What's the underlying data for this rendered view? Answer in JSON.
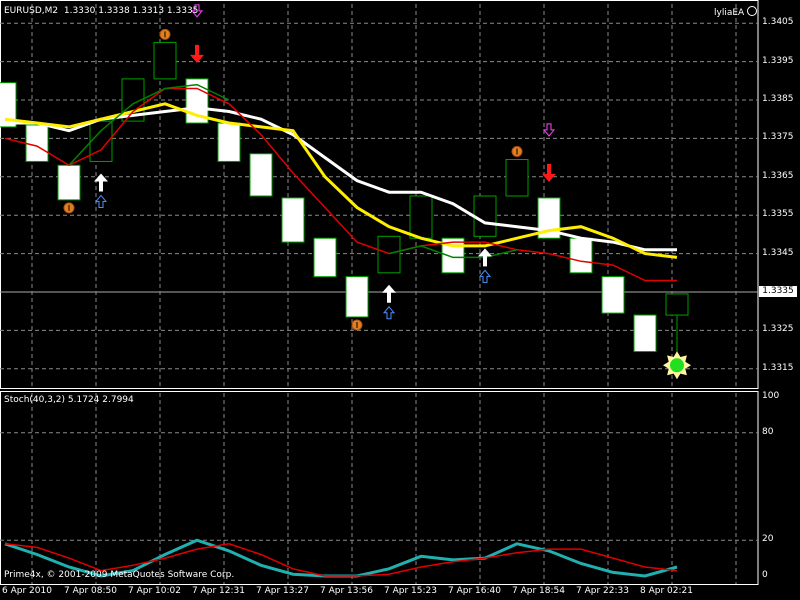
{
  "header": {
    "symbol": "EURUSD,M2",
    "quotes": "1.3330 1.3338 1.3313 1.3335",
    "ea_name": "lyliaEA"
  },
  "price_axis": {
    "ticks": [
      "1.3405",
      "1.3395",
      "1.3385",
      "1.3375",
      "1.3365",
      "1.3355",
      "1.3345",
      "1.3325",
      "1.3315"
    ],
    "current_price": "1.3335"
  },
  "stoch_panel": {
    "label": "Stoch(40,3,2) 5.1724 2.7994",
    "ticks": [
      "100",
      "80",
      "20",
      "0"
    ],
    "copyright": "Prime4x, © 2001-2009 MetaQuotes Software Corp."
  },
  "time_axis": {
    "labels": [
      "6 Apr 2010",
      "7 Apr 08:50",
      "7 Apr 10:02",
      "7 Apr 12:31",
      "7 Apr 13:27",
      "7 Apr 13:56",
      "7 Apr 15:23",
      "7 Apr 16:40",
      "7 Apr 18:54",
      "7 Apr 22:33",
      "8 Apr 02:21"
    ]
  },
  "colors": {
    "background": "#000000",
    "grid": "#8a8a8a",
    "bull_body": "#000000",
    "bear_body": "#ffffff",
    "candle_outline": "#00a000",
    "ma_red": "#e00000",
    "ma_green": "#008000",
    "ma_yellow": "#ffee00",
    "ma_white": "#ffffff",
    "stoch_main": "#20b0b0",
    "stoch_signal": "#e00000"
  },
  "chart_data": [
    {
      "type": "candlestick",
      "title": "EURUSD,M2",
      "ylim": [
        1.331,
        1.341
      ],
      "candles": [
        {
          "o": 1.33895,
          "c": 1.3378
        },
        {
          "o": 1.33785,
          "c": 1.3369
        },
        {
          "o": 1.3368,
          "c": 1.3359
        },
        {
          "o": 1.3369,
          "c": 1.33795
        },
        {
          "o": 1.33795,
          "c": 1.33905
        },
        {
          "o": 1.33905,
          "c": 1.34
        },
        {
          "o": 1.33905,
          "c": 1.3379
        },
        {
          "o": 1.3379,
          "c": 1.3369
        },
        {
          "o": 1.3371,
          "c": 1.336
        },
        {
          "o": 1.33595,
          "c": 1.3348
        },
        {
          "o": 1.3349,
          "c": 1.3339
        },
        {
          "o": 1.3339,
          "c": 1.33285
        },
        {
          "o": 1.334,
          "c": 1.33495
        },
        {
          "o": 1.3349,
          "c": 1.336
        },
        {
          "o": 1.3349,
          "c": 1.334
        },
        {
          "o": 1.33495,
          "c": 1.336
        },
        {
          "o": 1.336,
          "c": 1.33695
        },
        {
          "o": 1.33595,
          "c": 1.3349
        },
        {
          "o": 1.3349,
          "c": 1.334
        },
        {
          "o": 1.3339,
          "c": 1.33295
        },
        {
          "o": 1.3329,
          "c": 1.33195
        },
        {
          "o": 1.3329,
          "c": 1.33345,
          "low": 1.3318
        }
      ],
      "ma_red": [
        1.3375,
        1.3373,
        1.3368,
        1.3372,
        1.3382,
        1.3388,
        1.3388,
        1.3384,
        1.3376,
        1.3366,
        1.3357,
        1.3348,
        1.3345,
        1.3347,
        1.3348,
        1.3348,
        1.3346,
        1.3345,
        1.3343,
        1.3342,
        1.3338,
        1.3338
      ],
      "ma_green": [
        null,
        null,
        1.3368,
        1.3377,
        1.3384,
        1.3388,
        1.3389,
        1.3385,
        null,
        null,
        null,
        null,
        1.3345,
        1.3347,
        1.3344,
        1.3344,
        1.3346,
        null,
        null,
        null,
        null,
        null
      ],
      "ma_yellow": [
        1.338,
        1.3379,
        1.3378,
        1.338,
        1.3382,
        1.3384,
        1.3381,
        1.3379,
        1.3378,
        1.3377,
        1.3365,
        1.3357,
        1.3352,
        1.3349,
        1.3347,
        1.3347,
        1.3349,
        1.3351,
        1.3352,
        1.3349,
        1.3345,
        1.3344
      ],
      "ma_white": [
        1.3379,
        1.3379,
        1.3377,
        1.338,
        1.3381,
        1.3382,
        1.3383,
        1.3382,
        1.338,
        1.3376,
        1.337,
        1.3364,
        1.3361,
        1.3361,
        1.3358,
        1.3353,
        1.3352,
        1.3351,
        1.3349,
        1.3348,
        1.3346,
        1.3346
      ],
      "markers": [
        {
          "kind": "down-red",
          "i": 6
        },
        {
          "kind": "down-red",
          "i": 17
        },
        {
          "kind": "up-white",
          "i": 3
        },
        {
          "kind": "up-white",
          "i": 12
        },
        {
          "kind": "up-white",
          "i": 15
        },
        {
          "kind": "up-blue-outline",
          "i": 3
        },
        {
          "kind": "up-blue-outline",
          "i": 12
        },
        {
          "kind": "up-blue-outline",
          "i": 15
        },
        {
          "kind": "down-magenta-outline",
          "i": 6
        },
        {
          "kind": "down-magenta-outline",
          "i": 17
        },
        {
          "kind": "orange-circle",
          "i": 2,
          "at": "low"
        },
        {
          "kind": "orange-circle",
          "i": 5,
          "at": "high"
        },
        {
          "kind": "orange-circle",
          "i": 11,
          "at": "low"
        },
        {
          "kind": "orange-circle",
          "i": 16,
          "at": "high"
        },
        {
          "kind": "green-signal",
          "i": 21
        }
      ]
    },
    {
      "type": "line",
      "title": "Stoch(40,3,2) 5.1724 2.7994",
      "ylim": [
        0,
        100
      ],
      "series": [
        {
          "name": "main",
          "values": [
            18,
            12,
            5,
            0,
            3,
            12,
            20,
            14,
            6,
            1,
            0,
            0,
            4,
            11,
            9,
            10,
            18,
            14,
            7,
            2,
            0,
            5
          ]
        },
        {
          "name": "signal",
          "values": [
            18,
            16,
            10,
            3,
            6,
            10,
            15,
            18,
            12,
            4,
            0,
            0,
            1,
            5,
            8,
            10,
            13,
            15,
            15,
            10,
            5,
            3
          ]
        }
      ]
    }
  ]
}
